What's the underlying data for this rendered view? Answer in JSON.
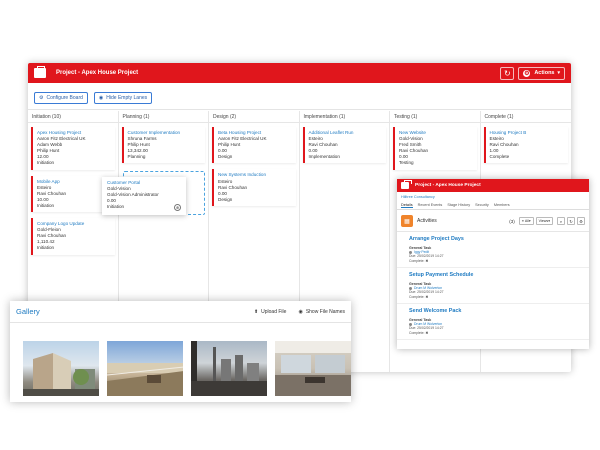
{
  "main": {
    "title": "Project - Apex House Project",
    "actions_label": "Actions",
    "configure_label": "Configure Board",
    "hide_lanes_label": "Hide Empty Lanes"
  },
  "lanes": [
    {
      "title": "Initiation (10)",
      "cards": [
        {
          "title": "Apex Housing Project",
          "lines": [
            "Aaron Fitz Electrical UK",
            "Adam Webb",
            "Philip Hunt",
            "12.00",
            "Initiation"
          ]
        },
        {
          "title": "Mobile App",
          "lines": [
            "Esteiro",
            "Ravi Chouhan",
            "10.00",
            "Initiation"
          ]
        },
        {
          "title": "Company Logo Update",
          "lines": [
            "Gold-Fleion",
            "Ravi Chouhan",
            "1,110.42",
            "Initiation"
          ]
        }
      ]
    },
    {
      "title": "Planning (1)",
      "cards": [
        {
          "title": "Customer Implementation",
          "lines": [
            "Shruna Farms",
            "Philip Hunt",
            "13,342.00",
            "Planning"
          ]
        }
      ]
    },
    {
      "title": "Design (2)",
      "cards": [
        {
          "title": "Beta Housing Project",
          "lines": [
            "Aaron Fitz Electrical UK",
            "Philip Hunt",
            "0.00",
            "Design"
          ]
        },
        {
          "title": "New Systems Induction",
          "lines": [
            "Esteiro",
            "Ravi Chouhan",
            "0.00",
            "Design"
          ]
        }
      ]
    },
    {
      "title": "Implementation (1)",
      "cards": [
        {
          "title": "Additional Leaflet Run",
          "lines": [
            "Esteiro",
            "Ravi Chouhan",
            "0.00",
            "Implementation"
          ]
        }
      ]
    },
    {
      "title": "Testing (1)",
      "cards": [
        {
          "title": "New Website",
          "lines": [
            "Gold-Vision",
            "Fred Smith",
            "Ravi Chouhan",
            "0.00",
            "Testing"
          ]
        }
      ]
    },
    {
      "title": "Complete (1)",
      "cards": [
        {
          "title": "Housing Project B",
          "lines": [
            "Esteiro",
            "Ravi Chouhan",
            "1.00",
            "Complete"
          ]
        }
      ]
    }
  ],
  "dragged_card": {
    "title": "Customer Portal",
    "lines": [
      "Gold-Vision",
      "Gold-Vision Administrator",
      "0.00",
      "Initiation"
    ]
  },
  "activity_window": {
    "title": "Project - Apex House Project",
    "company": "Hilltree Consultancy",
    "tabs": [
      "Details",
      "Recent Events",
      "Stage History",
      "Security",
      "Members"
    ],
    "activities_label": "Activities",
    "count": "(3)",
    "filter": "All",
    "view": "Views",
    "items": [
      {
        "title": "Arrange Project Days",
        "type": "General Task",
        "user": "Iggy Pedit",
        "due": "Due: 25/02/2019 14:27",
        "complete": "Complete:"
      },
      {
        "title": "Setup Payment Schedule",
        "type": "General Task",
        "user": "Drum M Wolverton",
        "due": "Due: 25/02/2019 14:27",
        "complete": "Complete:"
      },
      {
        "title": "Send Welcome Pack",
        "type": "General Task",
        "user": "Drum M Wolverton",
        "due": "Due: 25/02/2019 14:27",
        "complete": "Complete:"
      }
    ]
  },
  "gallery": {
    "title": "Gallery",
    "upload_label": "Upload File",
    "show_names_label": "Show File Names"
  },
  "colors": {
    "accent": "#e0161c",
    "link": "#1f7bc2"
  }
}
